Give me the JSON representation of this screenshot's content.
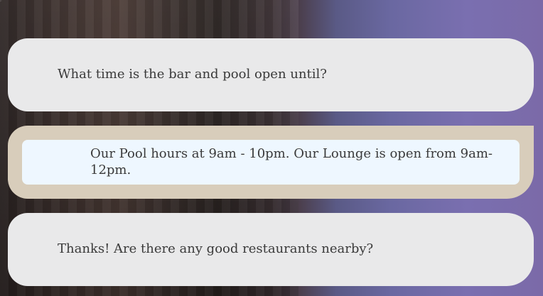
{
  "chat": {
    "messages": [
      {
        "role": "user",
        "text": "What time is the bar and pool open until?"
      },
      {
        "role": "assistant",
        "text": "Our Pool hours at 9am - 10pm. Our Lounge is open from 9am-12pm."
      },
      {
        "role": "user",
        "text": "Thanks! Are there any good restaurants nearby?"
      }
    ]
  },
  "colors": {
    "user_bubble_bg": "#e9e9ea",
    "assistant_bubble_outer": "#d8cdbb",
    "assistant_bubble_inner": "#eef7ff",
    "text": "#3a3a3a"
  }
}
